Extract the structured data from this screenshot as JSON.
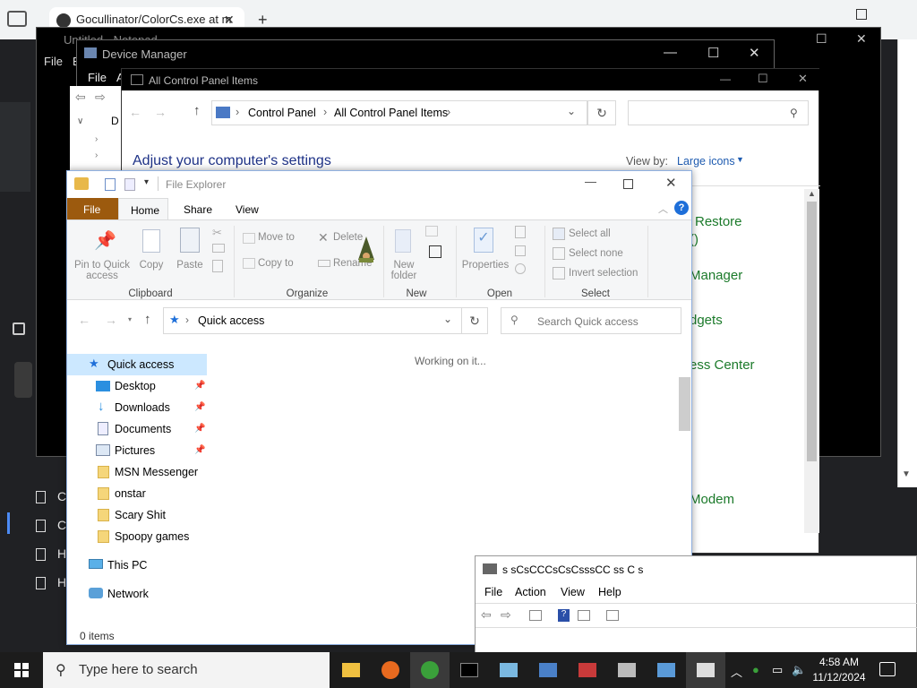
{
  "browser": {
    "tab_title": "Gocullinator/ColorCs.exe at m",
    "tab_close": "✕",
    "new_tab": "+",
    "sidebar_letters": [
      "C",
      "C",
      "H",
      "H"
    ]
  },
  "notepad": {
    "title": "Untitled - Notepad",
    "menu": [
      "File",
      "E"
    ]
  },
  "device_manager": {
    "title": "Device Manager",
    "menu": [
      "File",
      "A"
    ],
    "tree_letter": "D"
  },
  "control_panel": {
    "title": "All Control Panel Items",
    "breadcrumb": [
      "Control Panel",
      "All Control Panel Items"
    ],
    "heading": "Adjust your computer's settings",
    "view_by_label": "View by:",
    "view_by_value": "Large icons",
    "items": [
      "Restore",
      "()",
      "Manager",
      "dgets",
      "ess Center",
      "Modem"
    ]
  },
  "file_explorer": {
    "title": "File Explorer",
    "tabs": {
      "file": "File",
      "home": "Home",
      "share": "Share",
      "view": "View"
    },
    "ribbon": {
      "pin": "Pin to Quick access",
      "copy": "Copy",
      "paste": "Paste",
      "move_to": "Move to",
      "copy_to": "Copy to",
      "delete": "Delete",
      "rename": "Rename",
      "new_folder": "New folder",
      "properties": "Properties",
      "select_all": "Select all",
      "select_none": "Select none",
      "invert_selection": "Invert selection",
      "groups": [
        "Clipboard",
        "Organize",
        "New",
        "Open",
        "Select"
      ]
    },
    "address": "Quick access",
    "search_placeholder": "Search Quick access",
    "working": "Working on it...",
    "nav": {
      "quick_access": "Quick access",
      "pinned": [
        "Desktop",
        "Downloads",
        "Documents",
        "Pictures"
      ],
      "folders": [
        "MSN Messenger",
        "onstar",
        "Scary Shit",
        "Spoopy games"
      ],
      "this_pc": "This PC",
      "network": "Network"
    },
    "status": "0 items"
  },
  "mmc": {
    "title": "s sCsCCCsCsCsssCC ss   C    s",
    "menu": [
      "File",
      "Action",
      "View",
      "Help"
    ]
  },
  "taskbar": {
    "search_placeholder": "Type here to search",
    "time": "4:58 AM",
    "date": "11/12/2024"
  },
  "colors": {
    "file_tab": "#9c5a0e",
    "quick_access_selected": "#cce8ff",
    "cp_heading": "#1e3287",
    "cp_link": "#1b7a2a"
  }
}
